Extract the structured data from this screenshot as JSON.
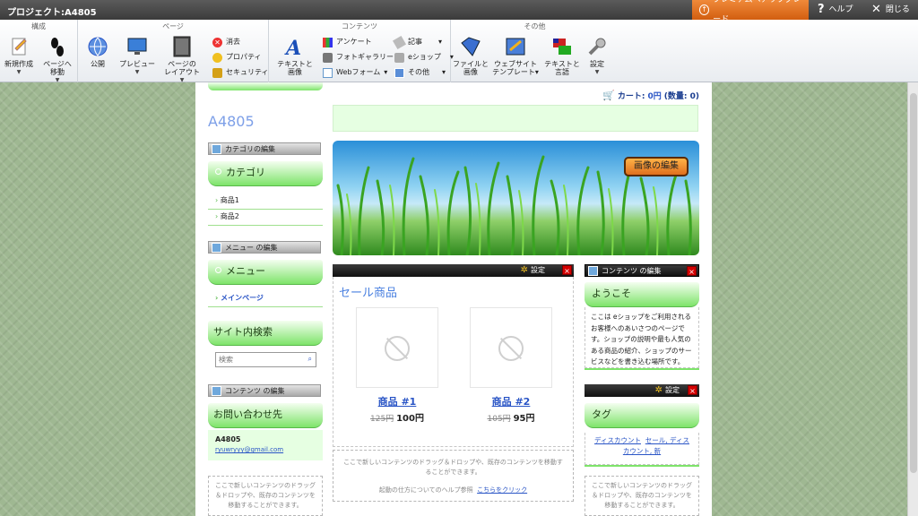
{
  "topbar": {
    "project": "プロジェクト:A4805",
    "premium": "プレミアムへアップグレード",
    "help": "ヘルプ",
    "close": "閉じる"
  },
  "ribbon": {
    "groups": {
      "compose": "構成",
      "page": "ページ",
      "content": "コンテンツ",
      "other": "その他"
    },
    "new": "新規作成",
    "goto_page_1": "ページへ",
    "goto_page_2": "移動",
    "publish": "公開",
    "preview": "プレビュー",
    "layout_1": "ページの",
    "layout_2": "レイアウト",
    "delete": "消去",
    "properties": "プロパティ",
    "security": "セキュリティ",
    "text_image_1": "テキストと",
    "text_image_2": "画像",
    "survey": "アンケート",
    "photo_gallery": "フォトギャラリー",
    "webform": "Webフォーム",
    "article": "記事",
    "eshop": "eショップ",
    "others": "その他",
    "file_image_1": "ファイルと",
    "file_image_2": "画像",
    "website_template_1": "ウェブサイト",
    "website_template_2": "テンプレート",
    "text_language_1": "テキストと",
    "text_language_2": "言語",
    "settings": "設定"
  },
  "cart": {
    "label": "カート:",
    "amount": "0円",
    "qty": "(数量: 0)"
  },
  "site": {
    "title": "A4805"
  },
  "banner": {
    "edit_image": "画像の編集"
  },
  "sidebar": {
    "edit_category": "カテゴリの編集",
    "category_title": "カテゴリ",
    "categories": [
      "商品1",
      "商品2"
    ],
    "edit_menu": "メニュー の編集",
    "menu_title": "メニュー",
    "menu_items": [
      "メインページ"
    ],
    "search_title": "サイト内検索",
    "search_placeholder": "検索",
    "edit_content": "コンテンツ の編集",
    "contact_title": "お問い合わせ先",
    "contact_name": "A4805",
    "contact_email": "ryuwryyy@gmail.com",
    "dropzone": "ここで新しいコンテンツのドラッグ＆ドロップや、既存のコンテンツを移動することができます。"
  },
  "main": {
    "settings": "設定",
    "sale_title": "セール商品",
    "products": [
      {
        "name": "商品 #1",
        "old": "125円",
        "price": "100円"
      },
      {
        "name": "商品 #2",
        "old": "105円",
        "price": "95円"
      }
    ],
    "dropzone": "ここで新しいコンテンツのドラッグ＆ドロップや、既存のコンテンツを移動することができます。",
    "help_text": "起動の仕方についてのヘルプ参照",
    "help_link": "こちらをクリック"
  },
  "right": {
    "edit_content": "コンテンツ の編集",
    "welcome_title": "ようこそ",
    "welcome_text": "ここは eショップをご利用される お客様へのあいさつのページです。ショップの説明や最も人気のある商品の紹介、ショップのサービスなどを書き込む場所です。",
    "settings": "設定",
    "tag_title": "タグ",
    "tag_links": [
      "ディスカウント",
      "セール, ディスカウント, 新"
    ],
    "dropzone": "ここで新しいコンテンツのドラッグ＆ドロップや、既存のコンテンツを移動することができます。"
  },
  "colors": {
    "accent_orange": "#e06f1e",
    "green": "#7ee46a",
    "link": "#2a55c6"
  }
}
